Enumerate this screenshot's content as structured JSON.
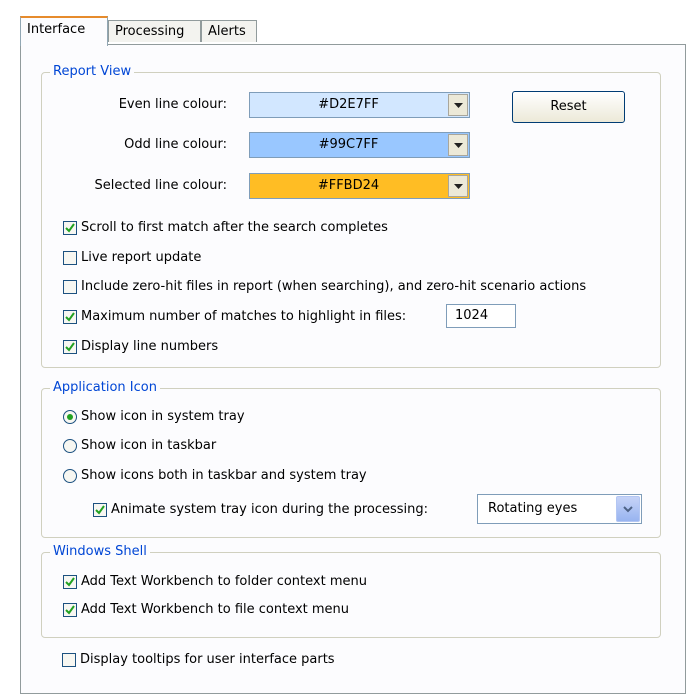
{
  "tabs": [
    {
      "label": "Interface",
      "active": true
    },
    {
      "label": "Processing",
      "active": false
    },
    {
      "label": "Alerts",
      "active": false
    }
  ],
  "report_view": {
    "title": "Report View",
    "even_label": "Even line colour:",
    "even_value": "#D2E7FF",
    "odd_label": "Odd line colour:",
    "odd_value": "#99C7FF",
    "selected_label": "Selected line colour:",
    "selected_value": "#FFBD24",
    "reset_label": "Reset",
    "options": {
      "scroll": {
        "label": "Scroll to first match after the search completes",
        "checked": true
      },
      "live": {
        "label": "Live report update",
        "checked": false
      },
      "zero_hit": {
        "label": "Include zero-hit files in report (when searching), and zero-hit scenario actions",
        "checked": false
      },
      "max_matches": {
        "label": "Maximum number of matches to highlight in files:",
        "checked": true,
        "value": "1024"
      },
      "line_numbers": {
        "label": "Display line numbers",
        "checked": true
      }
    }
  },
  "app_icon": {
    "title": "Application Icon",
    "tray": {
      "label": "Show icon in system tray",
      "selected": true
    },
    "taskbar": {
      "label": "Show icon in taskbar",
      "selected": false
    },
    "both": {
      "label": "Show icons both in taskbar and system tray",
      "selected": false
    },
    "animate": {
      "label": "Animate system tray icon during the processing:",
      "checked": true
    },
    "animation_value": "Rotating eyes"
  },
  "shell": {
    "title": "Windows Shell",
    "folder": {
      "label": "Add Text Workbench to folder context menu",
      "checked": true
    },
    "file": {
      "label": "Add Text Workbench to file context menu",
      "checked": true
    }
  },
  "tooltips": {
    "label": "Display tooltips for user interface parts",
    "checked": false
  }
}
